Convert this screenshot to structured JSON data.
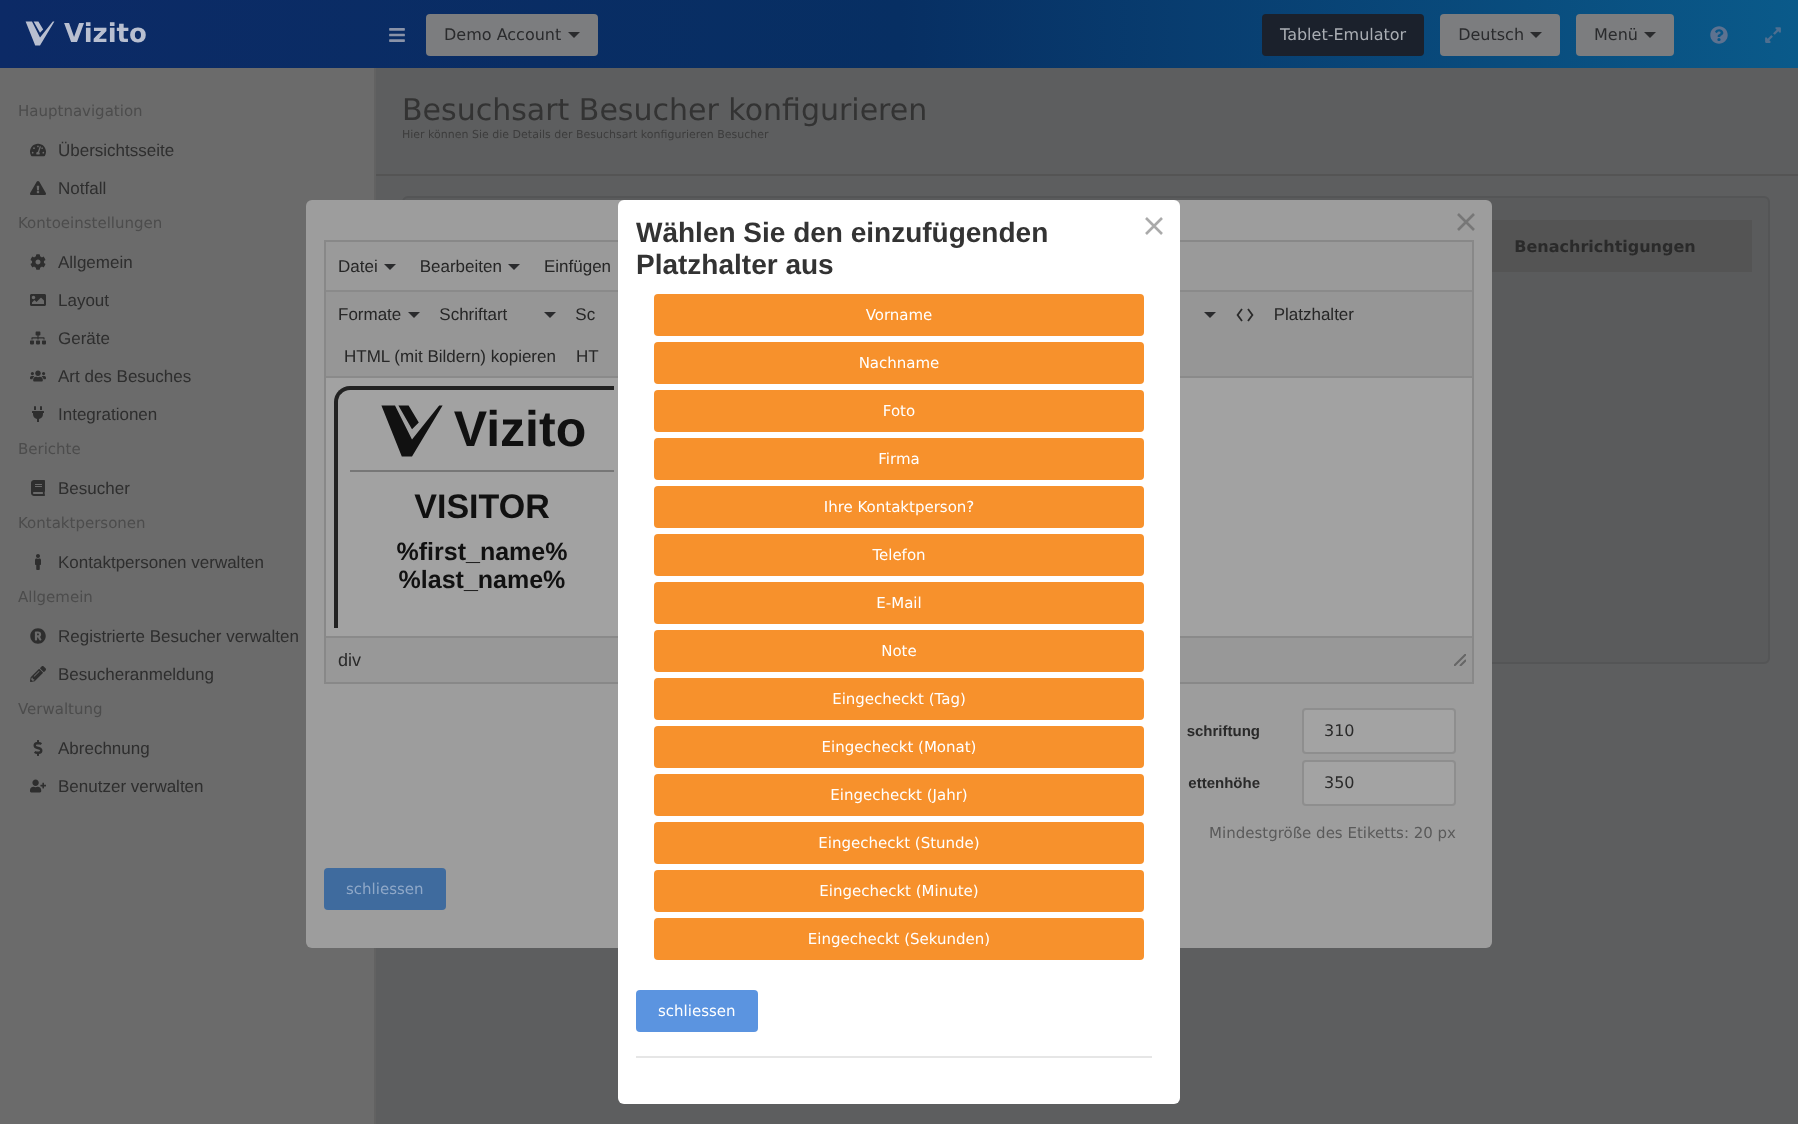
{
  "header": {
    "logo": "Vizito",
    "account": "Demo Account",
    "buttons": [
      {
        "label": "Tablet-Emulator",
        "kind": "dark"
      },
      {
        "label": "Deutsch",
        "kind": "dropdown"
      },
      {
        "label": "Menü",
        "kind": "dropdown"
      }
    ]
  },
  "sidebar": [
    {
      "heading": "Hauptnavigation",
      "items": [
        {
          "label": "Übersichtsseite"
        },
        {
          "label": "Notfall"
        }
      ]
    },
    {
      "heading": "Kontoeinstellungen",
      "items": [
        {
          "label": "Allgemein"
        },
        {
          "label": "Layout"
        },
        {
          "label": "Geräte"
        },
        {
          "label": "Art des Besuches"
        },
        {
          "label": "Integrationen"
        }
      ]
    },
    {
      "heading": "Berichte",
      "items": [
        {
          "label": "Besucher"
        }
      ]
    },
    {
      "heading": "Kontaktpersonen",
      "items": [
        {
          "label": "Kontaktpersonen verwalten"
        }
      ]
    },
    {
      "heading": "Allgemein",
      "items": [
        {
          "label": "Registrierte Besucher verwalten"
        },
        {
          "label": "Besucheranmeldung"
        }
      ]
    },
    {
      "heading": "Verwaltung",
      "items": [
        {
          "label": "Abrechnung"
        },
        {
          "label": "Benutzer verwalten"
        }
      ]
    }
  ],
  "page": {
    "title": "Besuchsart Besucher konfigurieren",
    "subtitle": "Hier können Sie die Details der Besuchsart konfigurieren Besucher",
    "tabs": [
      {
        "label": "Benachrichtigungen",
        "selected": false
      }
    ]
  },
  "editor_modal": {
    "menu": [
      "Datei",
      "Bearbeiten",
      "Einfügen"
    ],
    "toolbar_left": [
      {
        "label": "Formate",
        "kind": "dropdown"
      },
      {
        "label": "Schriftart",
        "kind": "select"
      },
      {
        "label": "Sc",
        "kind": "text"
      }
    ],
    "toolbar_right": [
      {
        "label": "Platzhalter"
      }
    ],
    "row2": [
      "HTML (mit Bildern) kopieren",
      "HT"
    ],
    "preview": {
      "logo": "Vizito",
      "title": "VISITOR",
      "lines": [
        "%first_name%",
        "%last_name%"
      ]
    },
    "status": "div",
    "fields": [
      {
        "label": "schriftung",
        "value": "310"
      },
      {
        "label": "ettenhöhe",
        "value": "350"
      }
    ],
    "hint": "Mindestgröße des Etiketts: 20 px",
    "close_button": "schliessen"
  },
  "picker": {
    "title": "Wählen Sie den einzufügenden Platzhalter aus",
    "options": [
      "Vorname",
      "Nachname",
      "Foto",
      "Firma",
      "Ihre Kontaktperson?",
      "Telefon",
      "E-Mail",
      "Note",
      "Eingecheckt (Tag)",
      "Eingecheckt (Monat)",
      "Eingecheckt (Jahr)",
      "Eingecheckt (Stunde)",
      "Eingecheckt (Minute)",
      "Eingecheckt (Sekunden)"
    ],
    "close_button": "schliessen"
  }
}
